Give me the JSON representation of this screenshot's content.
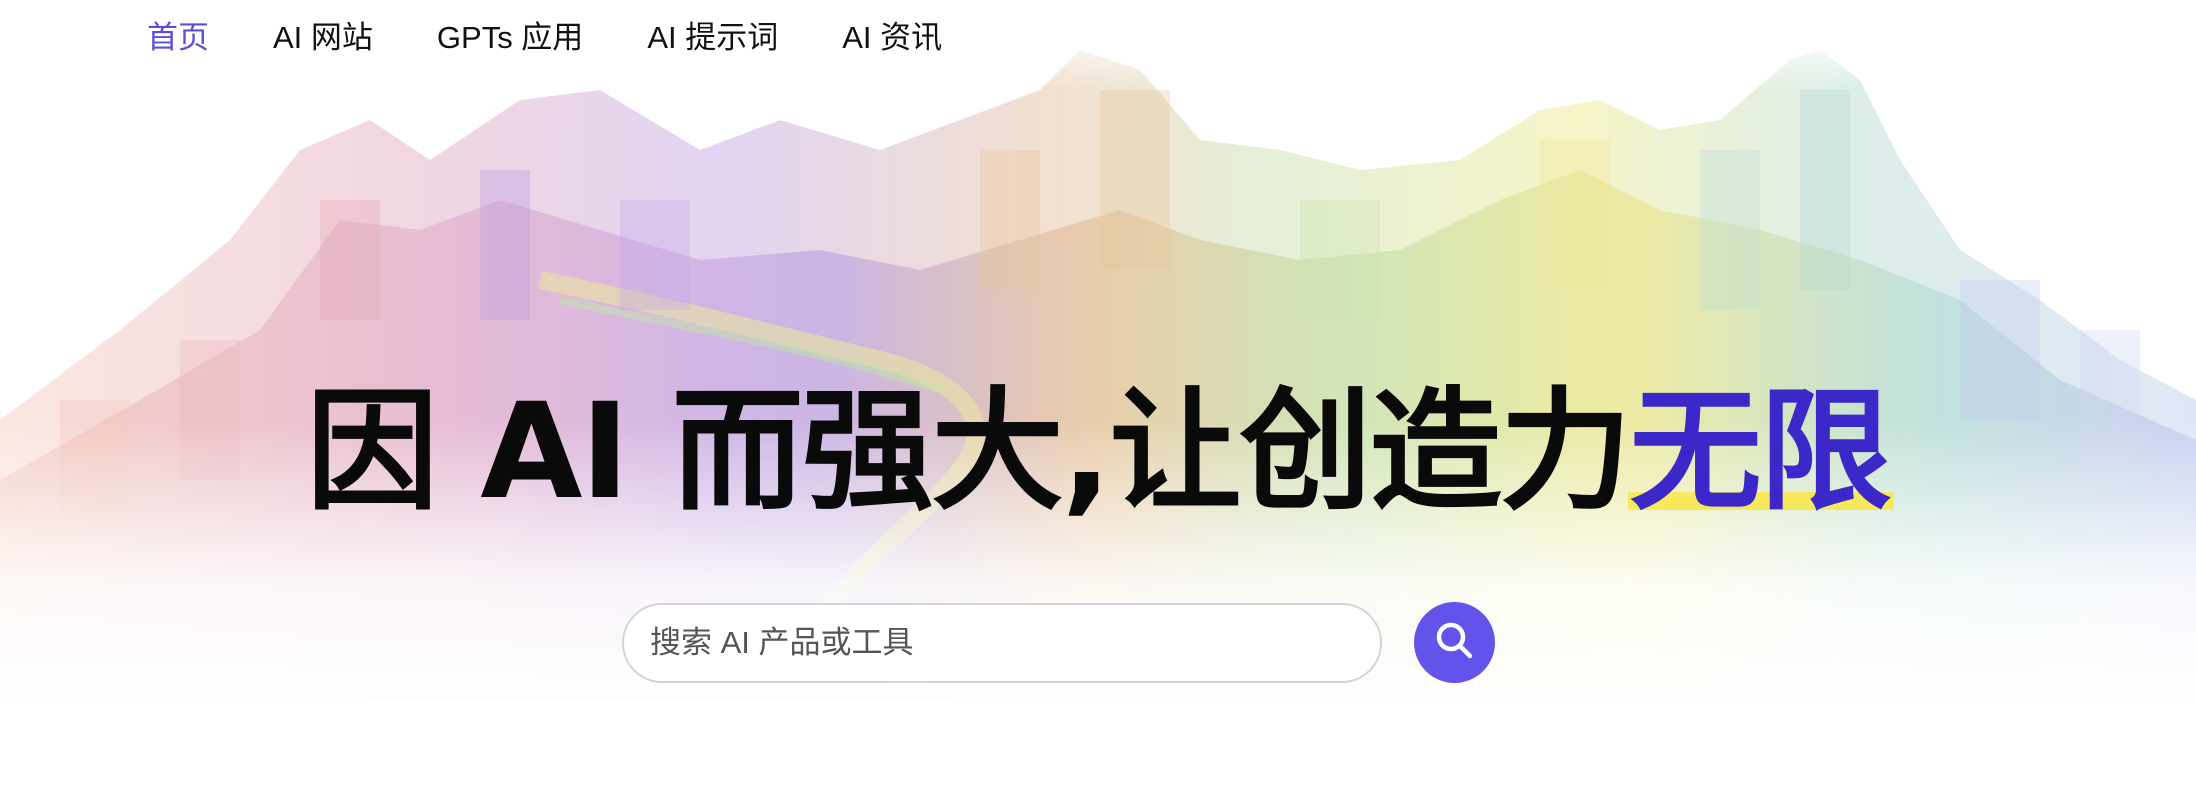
{
  "nav": {
    "items": [
      {
        "label": "首页",
        "active": true
      },
      {
        "label": "AI 网站",
        "active": false
      },
      {
        "label": "GPTs 应用",
        "active": false
      },
      {
        "label": "AI 提示词",
        "active": false
      },
      {
        "label": "AI 资讯",
        "active": false
      }
    ]
  },
  "hero": {
    "headline_main": "因 AI 而强大,让创造力",
    "headline_accent": "无限"
  },
  "search": {
    "placeholder": "搜索 AI 产品或工具",
    "button_icon": "search-icon"
  },
  "colors": {
    "accent": "#6353ea",
    "nav_active": "#5a4fd6",
    "headline_accent": "#3c28c8",
    "highlight": "#f6ea5c"
  }
}
